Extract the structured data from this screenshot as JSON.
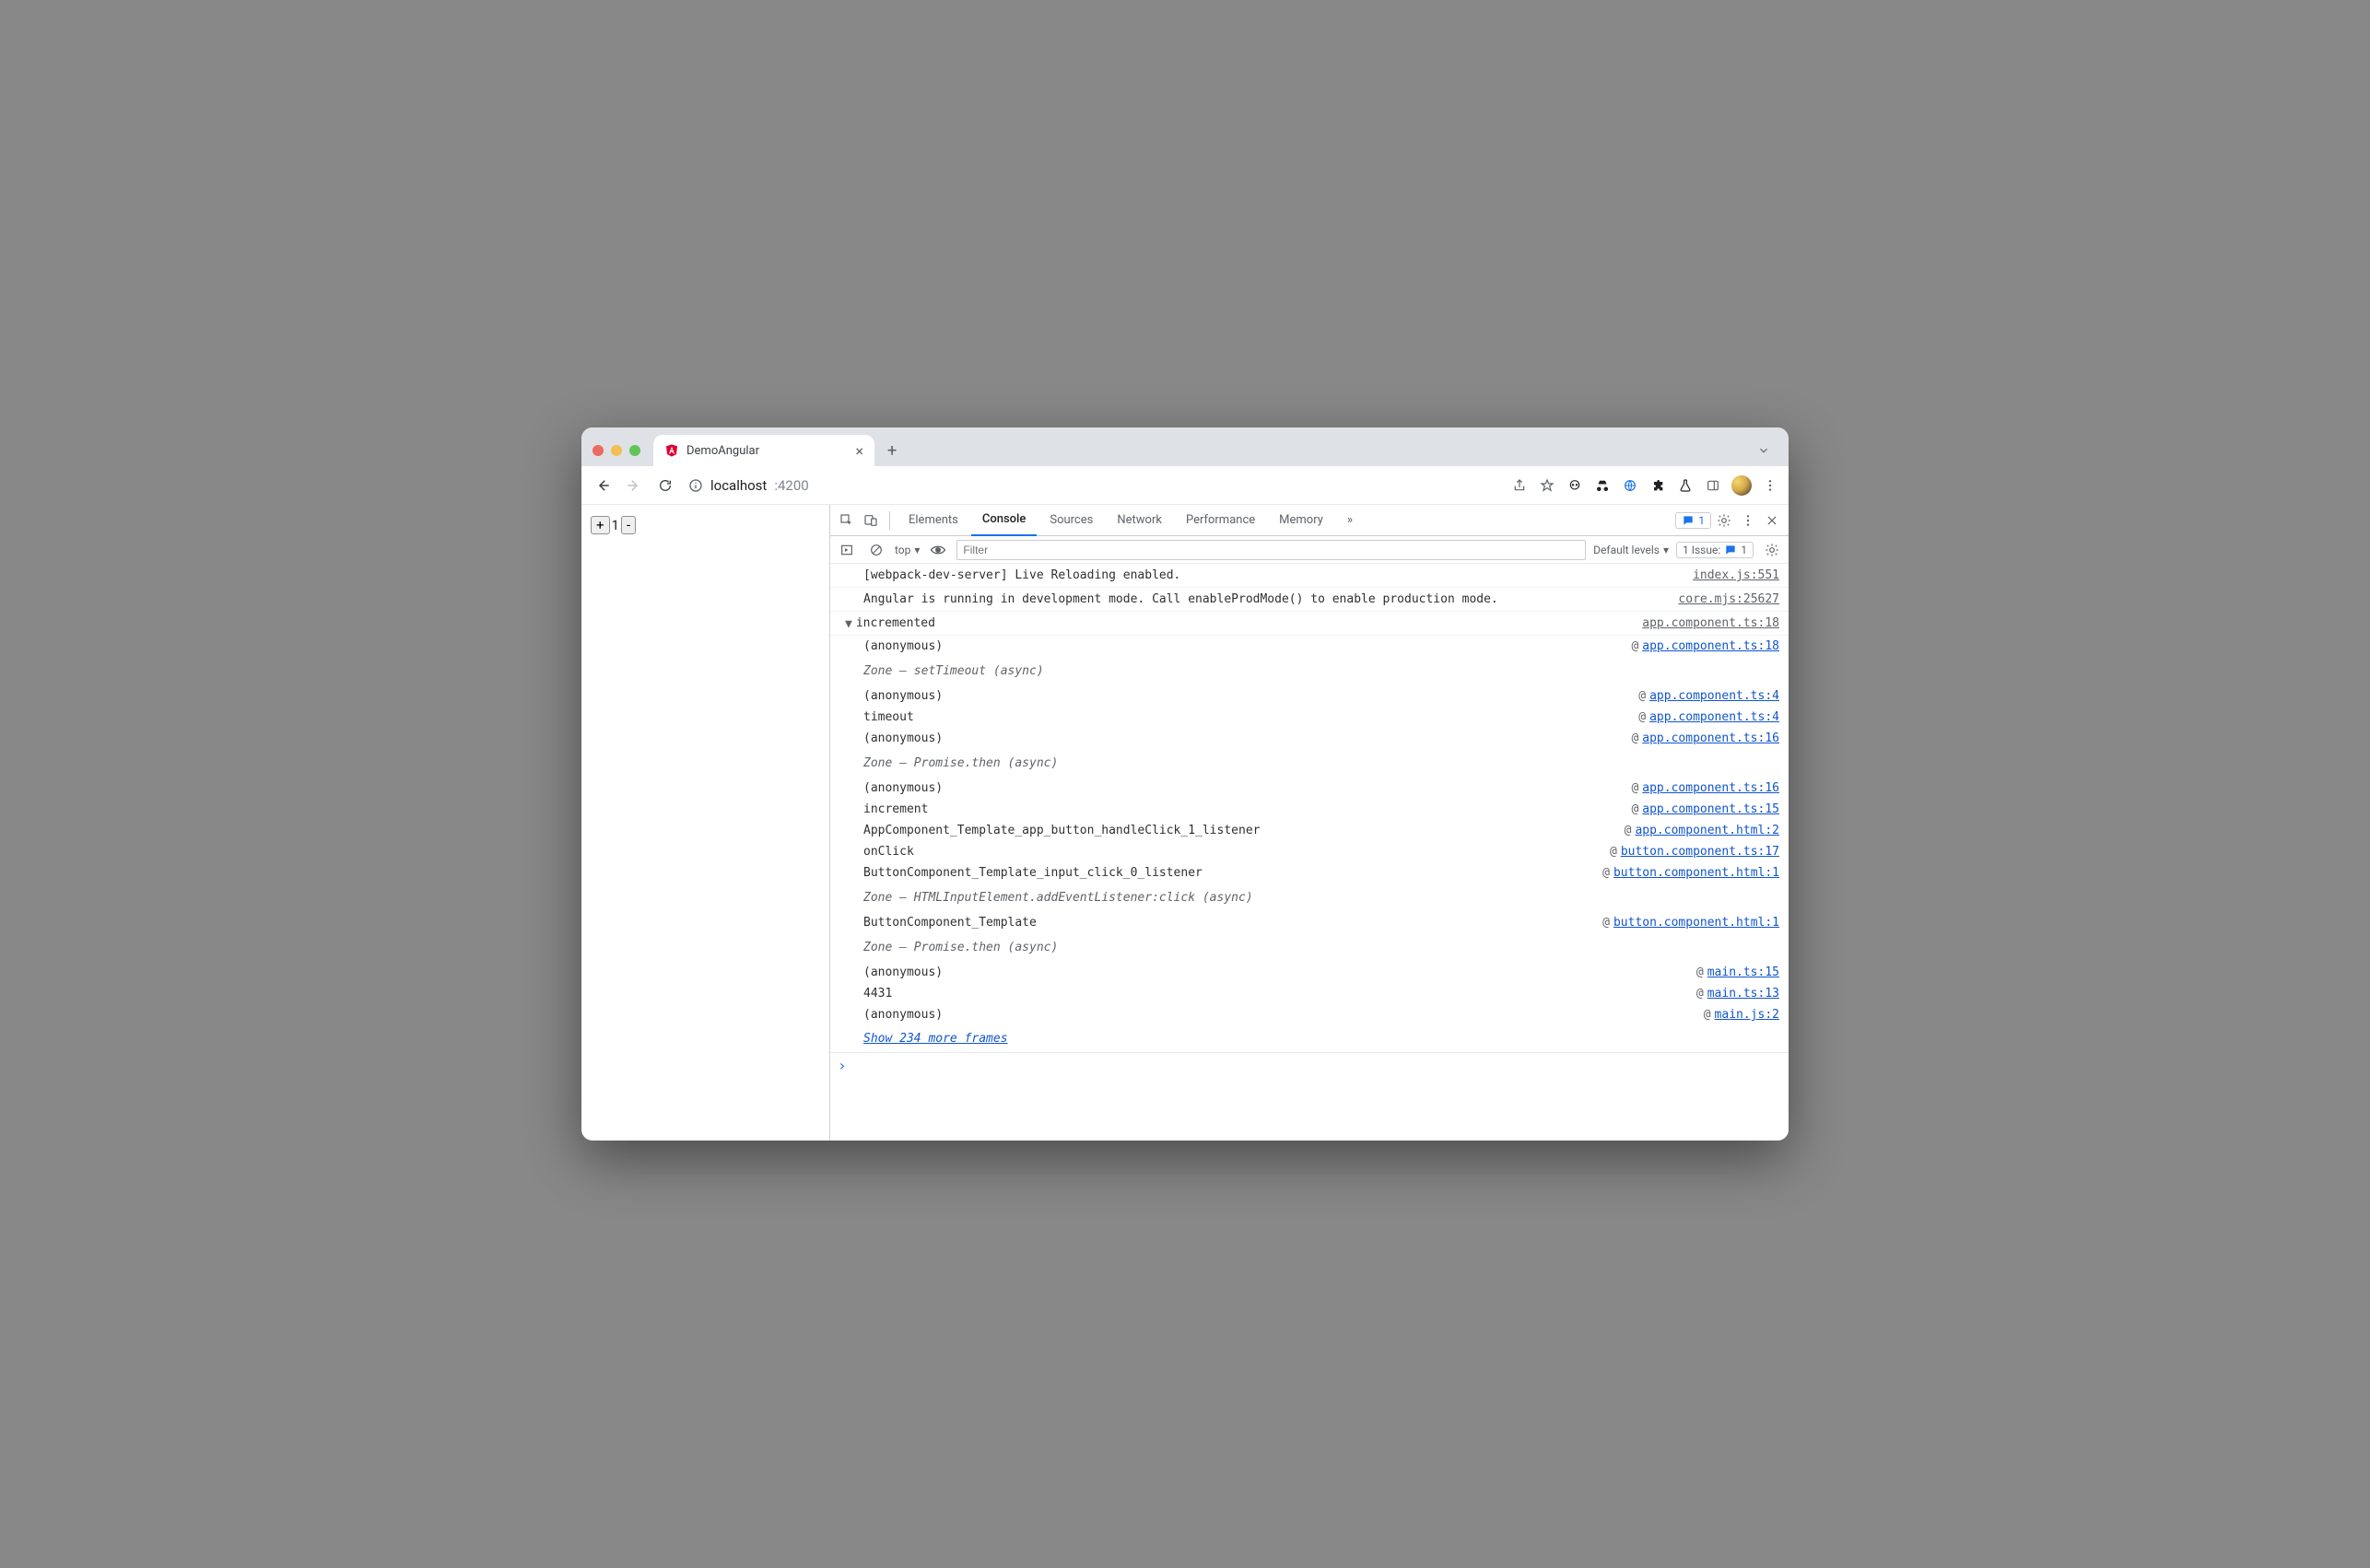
{
  "browser": {
    "tab_title": "DemoAngular",
    "url_host": "localhost",
    "url_path": ":4200"
  },
  "page": {
    "plus": "+",
    "minus": "-",
    "counter": "1"
  },
  "devtools": {
    "tabs": {
      "elements": "Elements",
      "console": "Console",
      "sources": "Sources",
      "network": "Network",
      "performance": "Performance",
      "memory": "Memory"
    },
    "overflow_glyph": "»",
    "msg_badge_count": "1",
    "console_tb": {
      "context": "top",
      "filter_placeholder": "Filter",
      "levels": "Default levels",
      "issue_label": "1 Issue:",
      "issue_count": "1"
    },
    "log": {
      "m0": {
        "text": "[webpack-dev-server] Live Reloading enabled.",
        "src": "index.js:551"
      },
      "m1": {
        "text": "Angular is running in development mode. Call enableProdMode() to enable production mode.",
        "src": "core.mjs:25627"
      }
    },
    "trace": {
      "header": "incremented",
      "header_src": "app.component.ts:18",
      "frames": [
        {
          "fn": "(anonymous)",
          "loc": "app.component.ts:18",
          "kind": "call"
        },
        {
          "fn": "Zone — setTimeout (async)",
          "kind": "zone"
        },
        {
          "fn": "(anonymous)",
          "loc": "app.component.ts:4",
          "kind": "call"
        },
        {
          "fn": "timeout",
          "loc": "app.component.ts:4",
          "kind": "call"
        },
        {
          "fn": "(anonymous)",
          "loc": "app.component.ts:16",
          "kind": "call"
        },
        {
          "fn": "Zone — Promise.then (async)",
          "kind": "zone"
        },
        {
          "fn": "(anonymous)",
          "loc": "app.component.ts:16",
          "kind": "call"
        },
        {
          "fn": "increment",
          "loc": "app.component.ts:15",
          "kind": "call"
        },
        {
          "fn": "AppComponent_Template_app_button_handleClick_1_listener",
          "loc": "app.component.html:2",
          "kind": "call"
        },
        {
          "fn": "onClick",
          "loc": "button.component.ts:17",
          "kind": "call"
        },
        {
          "fn": "ButtonComponent_Template_input_click_0_listener",
          "loc": "button.component.html:1",
          "kind": "call"
        },
        {
          "fn": "Zone — HTMLInputElement.addEventListener:click (async)",
          "kind": "zone"
        },
        {
          "fn": "ButtonComponent_Template",
          "loc": "button.component.html:1",
          "kind": "call"
        },
        {
          "fn": "Zone — Promise.then (async)",
          "kind": "zone"
        },
        {
          "fn": "(anonymous)",
          "loc": "main.ts:15",
          "kind": "call"
        },
        {
          "fn": "4431",
          "loc": "main.ts:13",
          "kind": "call"
        },
        {
          "fn": "(anonymous)",
          "loc": "main.js:2",
          "kind": "call"
        }
      ],
      "more": "Show 234 more frames"
    },
    "prompt_glyph": "›"
  }
}
